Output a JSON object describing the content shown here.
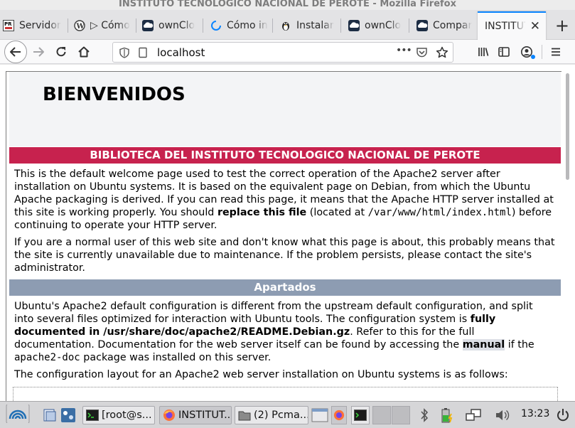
{
  "window": {
    "title": "INSTITUTO TECNOLOGICO NACIONAL DE PEROTE - Mozilla Firefox"
  },
  "tabs": [
    {
      "label": "Servidor",
      "icon": "pr-icon"
    },
    {
      "label": "▷ Cómo",
      "icon": "wordpress-icon"
    },
    {
      "label": "ownClo",
      "icon": "owncloud-icon"
    },
    {
      "label": "Cómo in",
      "icon": "loading-icon"
    },
    {
      "label": "Instalar",
      "icon": "linux-tux-icon"
    },
    {
      "label": "ownClo",
      "icon": "owncloud-icon"
    },
    {
      "label": "Compar",
      "icon": "owncloud-icon"
    },
    {
      "label": "INSTITUT",
      "icon": "none",
      "active": true,
      "close": "✕"
    }
  ],
  "newtab": {
    "label": "+"
  },
  "navbar": {
    "url": "localhost",
    "more": "•••"
  },
  "page": {
    "title": "BIENVENIDOS",
    "section1": {
      "heading": "BIBLIOTECA DEL INSTITUTO TECNOLOGICO NACIONAL DE PEROTE",
      "p1_a": "This is the default welcome page used to test the correct operation of the Apache2 server after installation on Ubuntu systems. It is based on the equivalent page on Debian, from which the Ubuntu Apache packaging is derived. If you can read this page, it means that the Apache HTTP server installed at this site is working properly. You should ",
      "p1_b": "replace this file",
      "p1_c": " (located at ",
      "p1_code": "/var/www/html/index.html",
      "p1_d": ") before continuing to operate your HTTP server.",
      "p2": "If you are a normal user of this web site and don't know what this page is about, this probably means that the site is currently unavailable due to maintenance. If the problem persists, please contact the site's administrator."
    },
    "section2": {
      "heading": "Apartados",
      "p3_a": "Ubuntu's Apache2 default configuration is different from the upstream default configuration, and split into several files optimized for interaction with Ubuntu tools. The configuration system is ",
      "p3_b": "fully documented in /usr/share/doc/apache2/README.Debian.gz",
      "p3_c": ". Refer to this for the full documentation. Documentation for the web server itself can be found by accessing the ",
      "p3_d": "manual",
      "p3_e": " if the ",
      "p3_code": "apache2-doc",
      "p3_f": " package was installed on this server.",
      "p4": "The configuration layout for an Apache2 web server installation on Ubuntu systems is as follows:"
    }
  },
  "taskbar": {
    "tasks": [
      {
        "label": "[root@s...",
        "icon": "terminal-icon"
      },
      {
        "label": "INSTITUT...",
        "icon": "firefox-icon",
        "active": true
      },
      {
        "label": "(2) Pcma...",
        "icon": "folder-icon"
      }
    ],
    "clock": "13:23"
  },
  "colors": {
    "section1": "#c7224e",
    "section2": "#8d9cb2",
    "tab_accent": "#0a84ff"
  }
}
